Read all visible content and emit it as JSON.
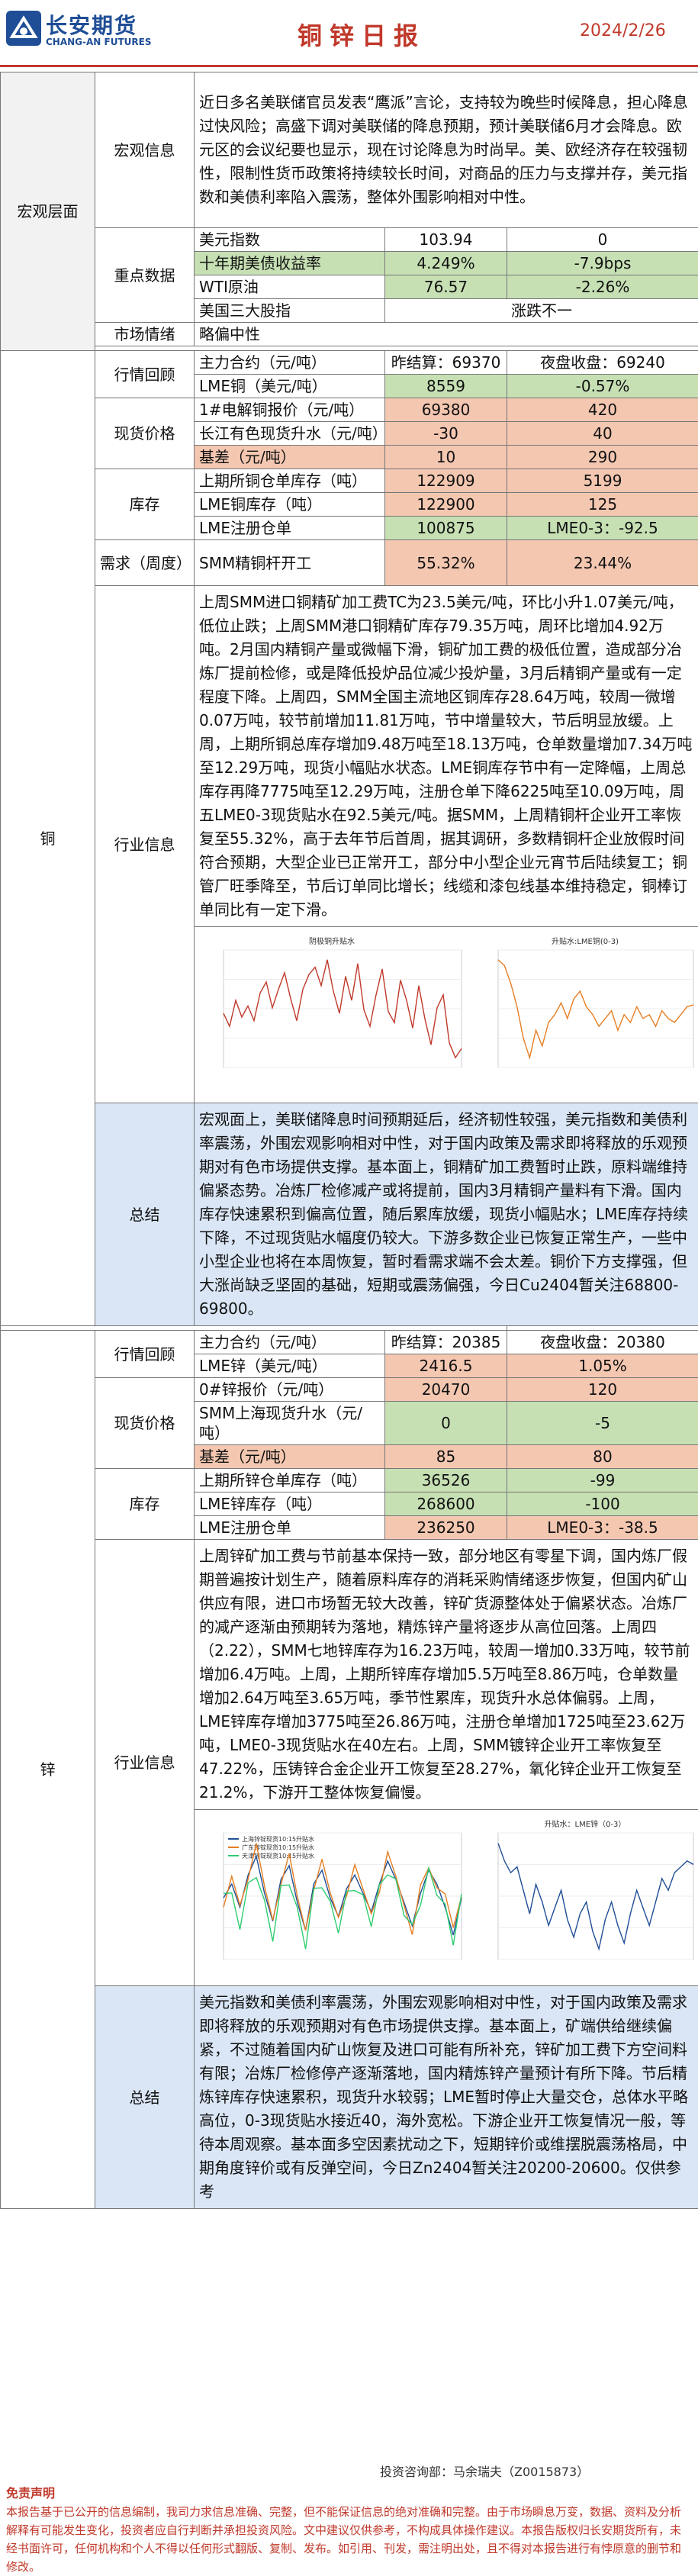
{
  "header": {
    "logo_cn": "长安期货",
    "logo_en": "CHANG-AN FUTURES",
    "title": "铜锌日报",
    "date": "2024/2/26"
  },
  "macro": {
    "section": "宏观层面",
    "info_label": "宏观信息",
    "info_text": "近日多名美联储官员发表“鹰派”言论，支持较为晚些时候降息，担心降息过快风险；高盛下调对美联储的降息预期，预计美联储6月才会降息。欧元区的会议纪要也显示，现在讨论降息为时尚早。美、欧经济存在较强韧性，限制性货币政策将持续较长时间，对商品的压力与支撑并存，美元指数和美债利率陷入震荡，整体外围影响相对中性。",
    "data_label": "重点数据",
    "rows": [
      [
        "美元指数",
        "103.94",
        "0"
      ],
      [
        "十年期美债收益率",
        "4.249%",
        "-7.9bps"
      ],
      [
        "WTI原油",
        "76.57",
        "-2.26%"
      ],
      [
        "美国三大股指",
        "涨跌不一",
        ""
      ]
    ],
    "sentiment_label": "市场情绪",
    "sentiment": "略偏中性"
  },
  "copper": {
    "section": "铜",
    "review_label": "行情回顾",
    "main_contract": "主力合约（元/吨）",
    "main_close": "昨结算：69370",
    "main_night": "夜盘收盘：69240",
    "lme_label": "LME铜（美元/吨）",
    "lme_val": "8559",
    "lme_chg": "-0.57%",
    "spot_label": "现货价格",
    "spot_rows": [
      [
        "1#电解铜报价（元/吨）",
        "69380",
        "420"
      ],
      [
        "长江有色现货升水（元/吨）",
        "-30",
        "40"
      ],
      [
        "基差（元/吨）",
        "10",
        "290"
      ]
    ],
    "stock_label": "库存",
    "stock_rows": [
      [
        "上期所铜仓单库存（吨）",
        "122909",
        "5199"
      ],
      [
        "LME铜库存（吨）",
        "122900",
        "125"
      ],
      [
        "LME注册仓单",
        "100875",
        "LME0-3：-92.5"
      ]
    ],
    "demand_label": "需求（周度）",
    "demand_row": [
      "SMM精铜杆开工",
      "55.32%",
      "23.44%"
    ],
    "industry_label": "行业信息",
    "industry_text": "上周SMM进口铜精矿加工费TC为23.5美元/吨，环比小升1.07美元/吨，低位止跌；上周SMM港口铜精矿库存79.35万吨，周环比增加4.92万吨。2月国内精铜产量或微幅下滑，铜矿加工费的极低位置，造成部分冶炼厂提前检修，或是降低投炉品位减少投炉量，3月后精铜产量或有一定程度下降。上周四，SMM全国主流地区铜库存28.64万吨，较周一微增0.07万吨，较节前增加11.81万吨，节中增量较大，节后明显放缓。上周，上期所铜总库存增加9.48万吨至18.13万吨，仓单数量增加7.34万吨至12.29万吨，现货小幅贴水状态。LME铜库存节中有一定降幅，上周总库存再降7775吨至12.29万吨，注册仓单下降6225吨至10.09万吨，周五LME0-3现货贴水在92.5美元/吨。据SMM，上周精铜杆企业开工率恢复至55.32%，高于去年节后首周，据其调研，多数精铜杆企业放假时间符合预期，大型企业已正常开工，部分中小型企业元宵节后陆续复工；铜管厂旺季降至，节后订单同比增长；线缆和漆包线基本维持稳定，铜棒订单同比有一定下滑。",
    "chart1": {
      "type": "line",
      "title": "阴极铜升贴水",
      "values": [
        130,
        60,
        200,
        110,
        170,
        90,
        240,
        300,
        160,
        260,
        350,
        210,
        90,
        260,
        340,
        380,
        280,
        420,
        250,
        130,
        330,
        200,
        400,
        150,
        60,
        230,
        370,
        140,
        80,
        310,
        200,
        50,
        280,
        100,
        -40,
        160,
        230,
        -30,
        -110,
        -60
      ]
    },
    "chart2": {
      "type": "line",
      "title": "升贴水:LME铜(0-3)",
      "values": [
        20,
        5,
        -40,
        -100,
        -180,
        -230,
        -160,
        -200,
        -140,
        -120,
        -90,
        -130,
        -80,
        -60,
        -100,
        -120,
        -150,
        -130,
        -110,
        -160,
        -120,
        -140,
        -100,
        -130,
        -120,
        -150,
        -110,
        -130,
        -140,
        -120,
        -100,
        -95
      ]
    },
    "summary_label": "总结",
    "summary_text": "宏观面上，美联储降息时间预期延后，经济韧性较强，美元指数和美债利率震荡，外围宏观影响相对中性，对于国内政策及需求即将释放的乐观预期对有色市场提供支撑。基本面上，铜精矿加工费暂时止跌，原料端维持偏紧态势。冶炼厂检修减产或将提前，国内3月精铜产量料有下滑。国内库存快速累积到偏高位置，随后累库放缓，现货小幅贴水；LME库存持续下降，不过现货贴水幅度仍较大。下游多数企业已恢复正常生产，一些中小型企业也将在本周恢复，暂时看需求端不会太差。铜价下方支撑强，但大涨尚缺乏坚固的基础，短期或震荡偏强，今日Cu2404暂关注68800-69800。"
  },
  "zinc": {
    "section": "锌",
    "review_label": "行情回顾",
    "main_contract": "主力合约（元/吨）",
    "main_close": "昨结算：20385",
    "main_night": "夜盘收盘：20380",
    "lme_label": "LME锌（美元/吨）",
    "lme_val": "2416.5",
    "lme_chg": "1.05%",
    "spot_label": "现货价格",
    "spot_rows": [
      [
        "0#锌报价（元/吨）",
        "20470",
        "120"
      ],
      [
        "SMM上海现货升水（元/吨）",
        "0",
        "-5"
      ],
      [
        "基差（元/吨）",
        "85",
        "80"
      ]
    ],
    "stock_label": "库存",
    "stock_rows": [
      [
        "上期所锌仓单库存（吨）",
        "36526",
        "-99"
      ],
      [
        "LME锌库存（吨）",
        "268600",
        "-100"
      ],
      [
        "LME注册仓单",
        "236250",
        "LME0-3：-38.5"
      ]
    ],
    "industry_label": "行业信息",
    "industry_text": "上周锌矿加工费与节前基本保持一致，部分地区有零星下调，国内炼厂假期普遍按计划生产，随着原料库存的消耗采购情绪逐步恢复，但国内矿山供应有限，进口市场暂无较大改善，锌矿货源整体处于偏紧状态。冶炼厂的减产逐渐由预期转为落地，精炼锌产量将逐步从高位回落。上周四（2.22），SMM七地锌库存为16.23万吨，较周一增加0.33万吨，较节前增加6.4万吨。上周，上期所锌库存增加5.5万吨至8.86万吨，仓单数量增加2.64万吨至3.65万吨，季节性累库，现货升水总体偏弱。上周，LME锌库存增加3775吨至26.86万吨，注册仓单增加1725吨至23.62万吨，LME0-3现货贴水在40左右。上周，SMM镀锌企业开工率恢复至47.22%，压铸锌合金企业开工恢复至28.27%，氧化锌企业开工恢复至21.2%，下游开工整体恢复偏慢。",
    "chart1": {
      "type": "line",
      "title": "",
      "legend": [
        "上海锌锭现货10:15升贴水",
        "广东锌锭现货10:15升贴水",
        "天津锌锭现货10:15升贴水"
      ]
    },
    "chart2": {
      "type": "line",
      "title": "升贴水：LME锌（0-3）",
      "values": [
        -20,
        -35,
        -45,
        -40,
        -60,
        -80,
        -55,
        -70,
        -90,
        -75,
        -60,
        -85,
        -100,
        -80,
        -70,
        -95,
        -110,
        -85,
        -70,
        -90,
        -105,
        -80,
        -60,
        -75,
        -90,
        -70,
        -50,
        -60,
        -45,
        -40,
        -35,
        -38
      ]
    },
    "summary_label": "总结",
    "summary_text": "美元指数和美债利率震荡，外围宏观影响相对中性，对于国内政策及需求即将释放的乐观预期对有色市场提供支撑。基本面上，矿端供给继续偏紧，不过随着国内矿山恢复及进口可能有所补充，锌矿加工费下方空间料有限；冶炼厂检修停产逐渐落地，国内精炼锌产量预计有所下降。节后精炼锌库存快速累积，现货升水较弱；LME暂时停止大量交仓，总体水平略高位，0-3现货贴水接近40，海外宽松。下游企业开工恢复情况一般，等待本周观察。基本面多空因素扰动之下，短期锌价或维摆脱震荡格局，中期角度锌价或有反弹空间，今日Zn2404暂关注20200-20600。仅供参考"
  },
  "footer": {
    "advisor": "投资咨询部：马余瑞夫（Z0015873）",
    "disclaimer_title": "免责声明",
    "disclaimer": "本报告基于已公开的信息编制，我司力求信息准确、完整，但不能保证信息的绝对准确和完整。由于市场瞬息万变，数据、资料及分析解释有可能发生变化，投资者应自行判断并承担投资风险。文中建议仅供参考，不构成具体操作建议。本报告版权归长安期货所有，未经书面许可，任何机构和个人不得以任何形式翻版、复制、发布。如引用、刊发，需注明出处，且不得对本报告进行有悖原意的删节和修改。"
  }
}
